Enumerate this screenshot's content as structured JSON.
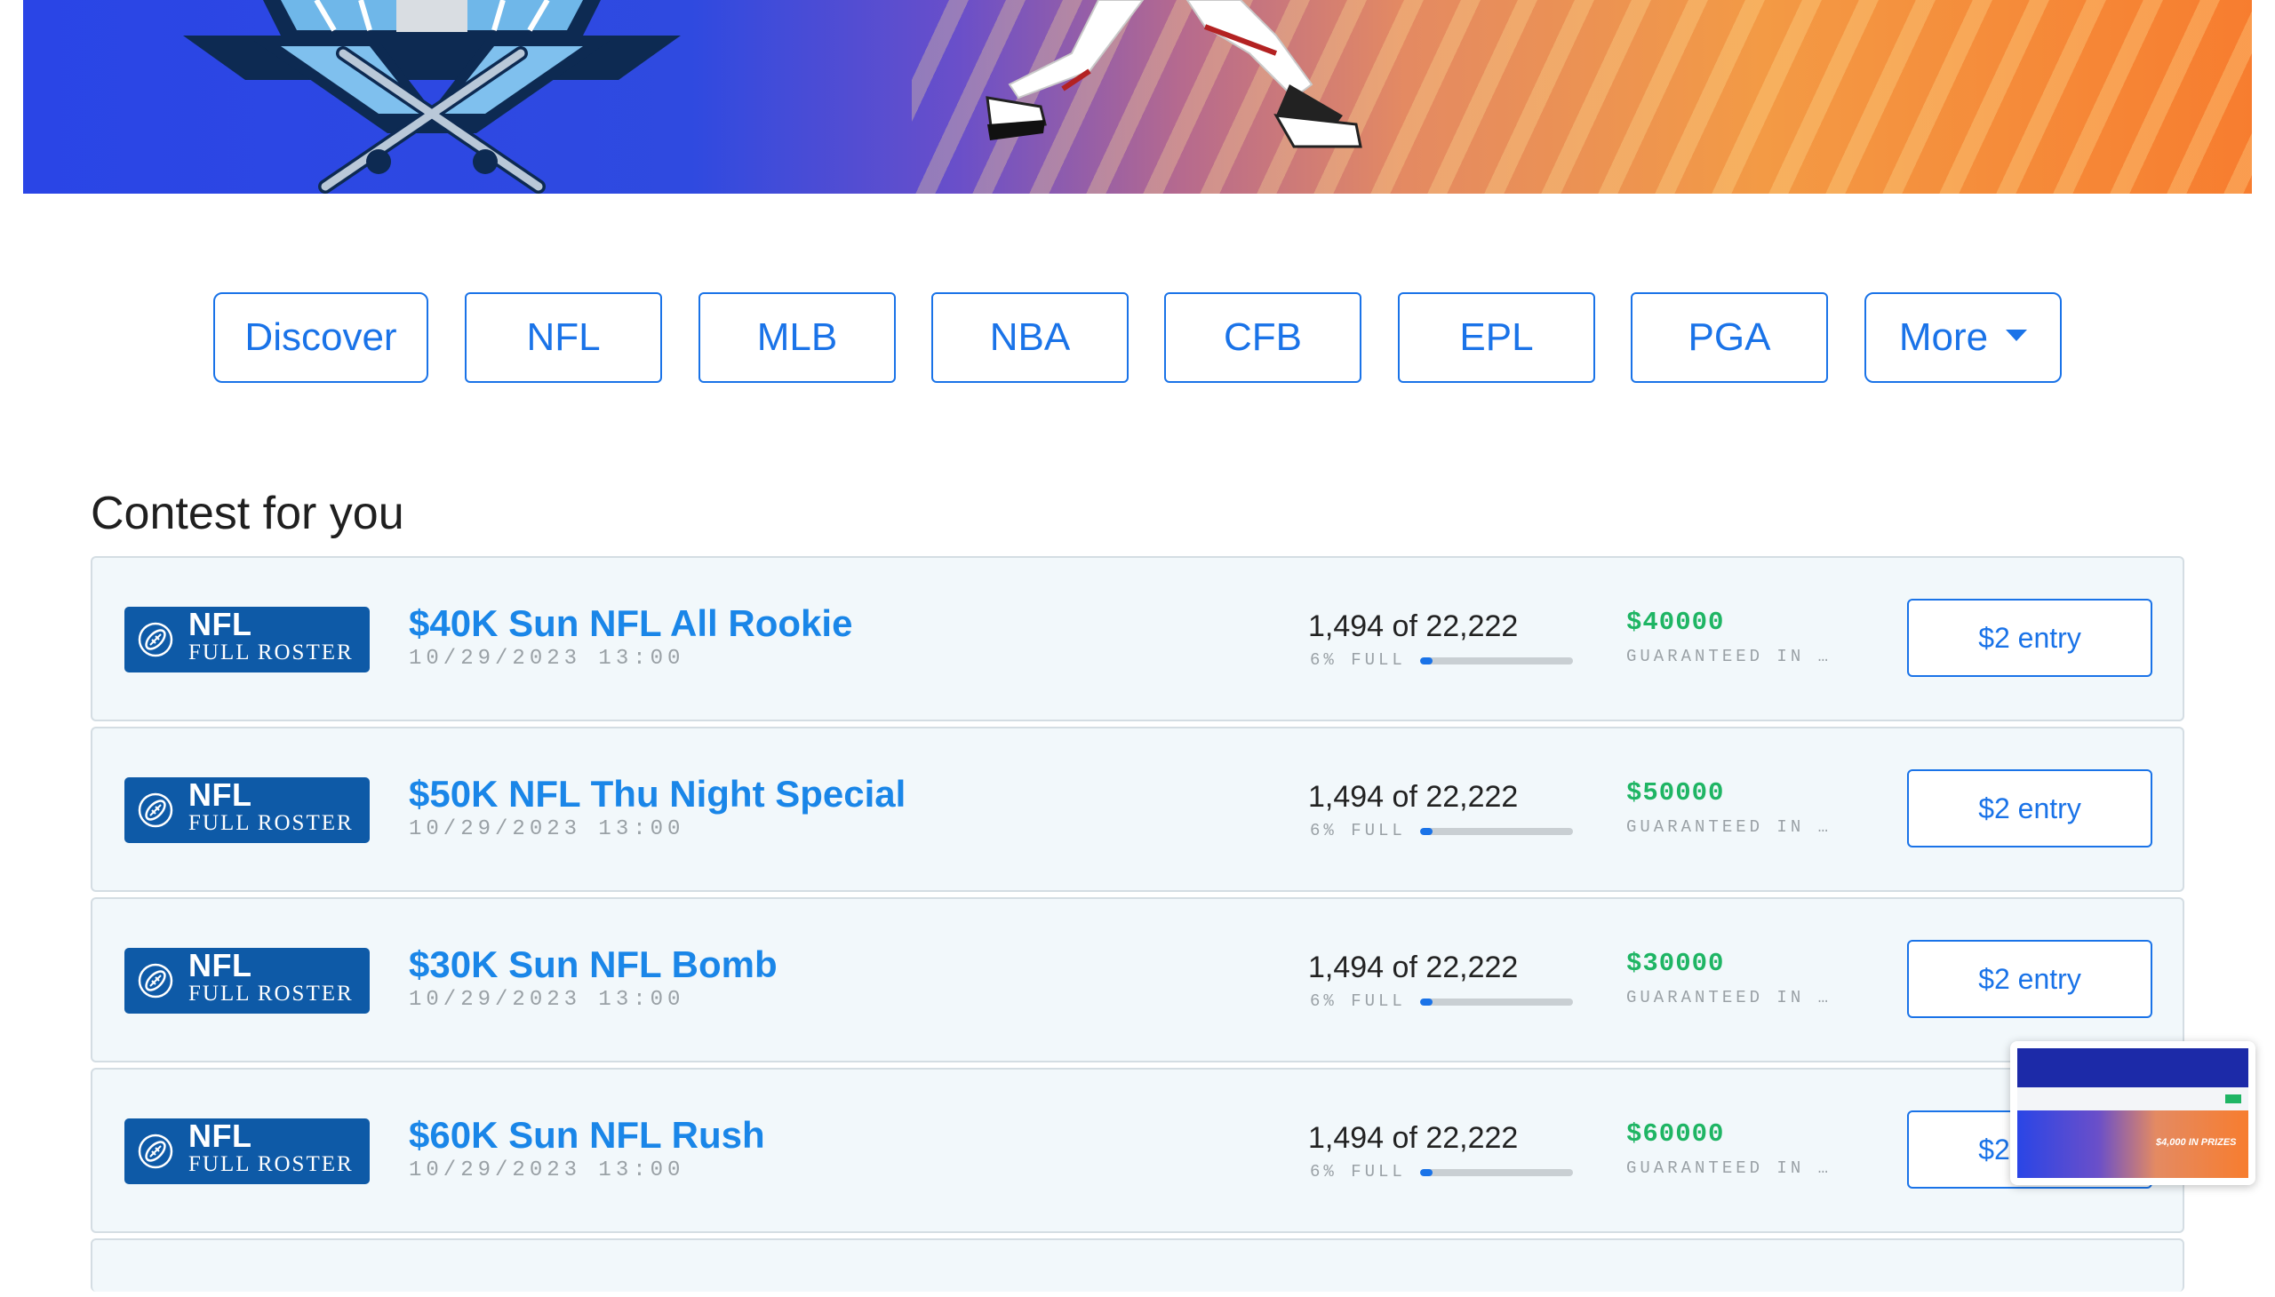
{
  "hero": {
    "background_gradient": [
      "#2a45e6",
      "#6a4fc9",
      "#e48a62",
      "#f77d2f"
    ]
  },
  "sport_tabs": [
    {
      "label": "Discover"
    },
    {
      "label": "NFL"
    },
    {
      "label": "MLB"
    },
    {
      "label": "NBA"
    },
    {
      "label": "CFB"
    },
    {
      "label": "EPL"
    },
    {
      "label": "PGA"
    },
    {
      "label": "More",
      "icon": "caret-down-icon"
    }
  ],
  "section": {
    "title": "Contest for you"
  },
  "contests": [
    {
      "badge_sport": "NFL",
      "badge_type": "FULL ROSTER",
      "badge_icon": "football-icon",
      "title": "$40K Sun NFL All Rookie",
      "date": "10/29/2023 13:00",
      "entries": "1,494 of 22,222",
      "full_label": "6% FULL",
      "fill_fraction": 0.06,
      "prize": "$40000",
      "guarantee": "GUARANTEED IN …",
      "entry_label": "$2 entry"
    },
    {
      "badge_sport": "NFL",
      "badge_type": "FULL ROSTER",
      "badge_icon": "football-icon",
      "title": "$50K NFL Thu Night Special",
      "date": "10/29/2023 13:00",
      "entries": "1,494 of 22,222",
      "full_label": "6% FULL",
      "fill_fraction": 0.06,
      "prize": "$50000",
      "guarantee": "GUARANTEED IN …",
      "entry_label": "$2 entry"
    },
    {
      "badge_sport": "NFL",
      "badge_type": "FULL ROSTER",
      "badge_icon": "football-icon",
      "title": "$30K Sun NFL Bomb",
      "date": "10/29/2023 13:00",
      "entries": "1,494 of 22,222",
      "full_label": "6% FULL",
      "fill_fraction": 0.06,
      "prize": "$30000",
      "guarantee": "GUARANTEED IN …",
      "entry_label": "$2 entry"
    },
    {
      "badge_sport": "NFL",
      "badge_type": "FULL ROSTER",
      "badge_icon": "football-icon",
      "title": "$60K Sun NFL Rush",
      "date": "10/29/2023 13:00",
      "entries": "1,494 of 22,222",
      "full_label": "6% FULL",
      "fill_fraction": 0.06,
      "prize": "$60000",
      "guarantee": "GUARANTEED IN …",
      "entry_label": "$2 entry"
    }
  ],
  "thumbnail": {
    "prize_text": "$4,000 IN PRIZES"
  },
  "colors": {
    "accent": "#1a73e8",
    "title_blue": "#1a86e8",
    "badge_bg": "#0e5aa7",
    "prize_green": "#1fb564",
    "card_bg": "#f2f8fb"
  }
}
